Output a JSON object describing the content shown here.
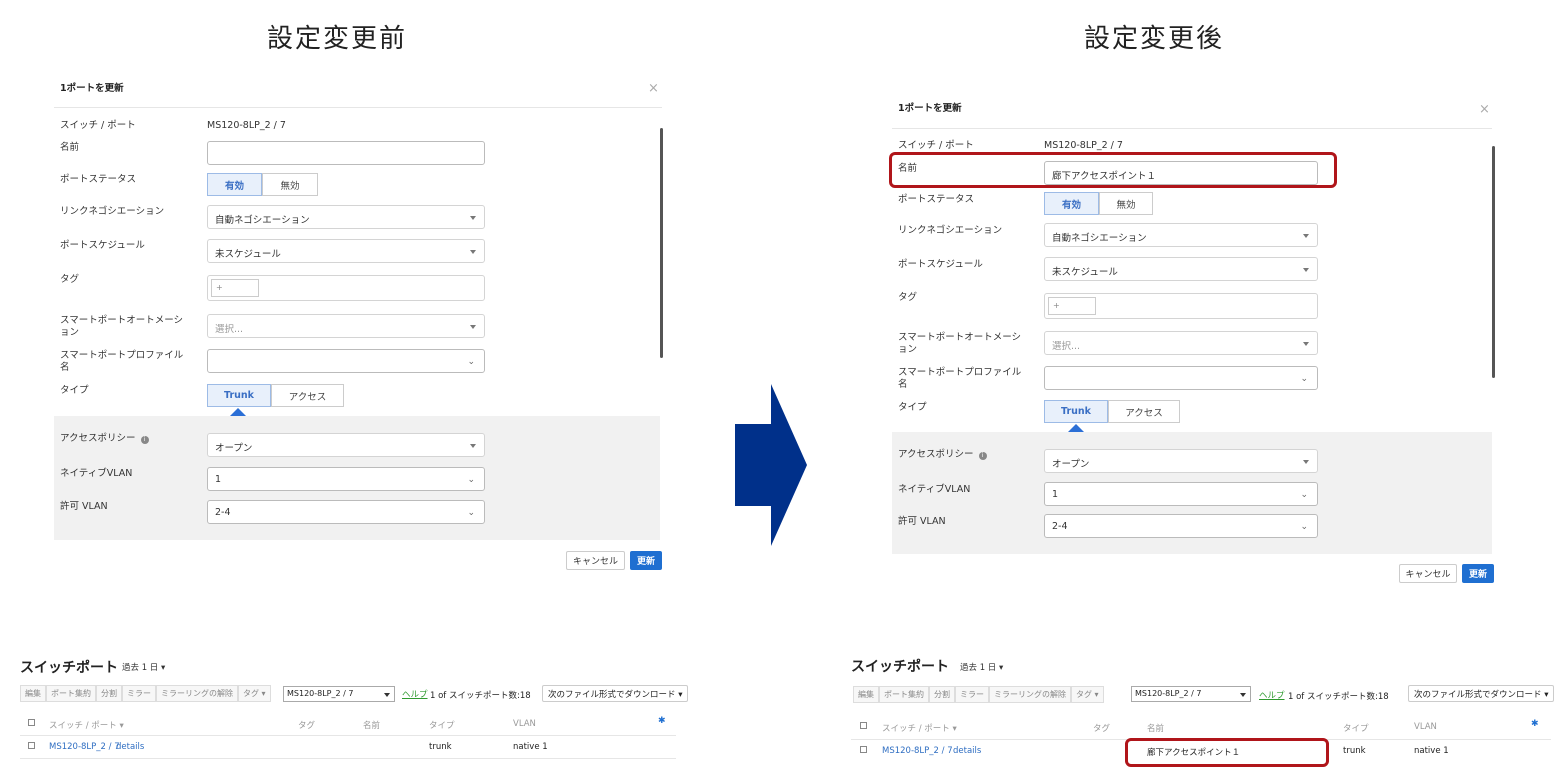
{
  "headings": {
    "before": "設定変更前",
    "after": "設定変更後"
  },
  "modal": {
    "title": "1ポートを更新",
    "close": "×",
    "labels": {
      "switch_port": "スイッチ / ポート",
      "name": "名前",
      "port_status": "ポートステータス",
      "link_negotiation": "リンクネゴシエーション",
      "port_schedule": "ポートスケジュール",
      "tag": "タグ",
      "smart_automation": "スマートポートオートメーション",
      "smart_automation_line1": "スマートポートオートメーシ",
      "smart_automation_line2": "ョン",
      "smart_profile_line1": "スマートポートプロファイル",
      "smart_profile_line2": "名",
      "type": "タイプ",
      "access_policy": "アクセスポリシー",
      "native_vlan": "ネイティブVLAN",
      "allowed_vlan": "許可 VLAN"
    },
    "switch_port_value": "MS120-8LP_2 / 7",
    "status_enabled": "有効",
    "status_disabled": "無効",
    "link_negotiation_value": "自動ネゴシエーション",
    "schedule_value": "未スケジュール",
    "tag_placeholder": "+",
    "automation_placeholder": "選択...",
    "type_trunk": "Trunk",
    "type_access": "アクセス",
    "info_icon": "i",
    "access_policy_value": "オープン",
    "native_vlan_value": "1",
    "allowed_vlan_value": "2-4",
    "cancel": "キャンセル",
    "update": "更新"
  },
  "before": {
    "name_value": ""
  },
  "after": {
    "name_value": "廊下アクセスポイント１"
  },
  "table": {
    "title": "スイッチポート",
    "period": "過去 1 日 ▾",
    "toolbar": [
      "編集",
      "ポート集約",
      "分割",
      "ミラー",
      "ミラーリングの解除",
      "タグ ▾"
    ],
    "filter_value": "MS120-8LP_2 / 7",
    "help": "ヘルプ",
    "count": "1 of スイッチポート数:18",
    "download": "次のファイル形式でダウンロード ▾",
    "headers": {
      "switch_port": "スイッチ / ポート ▾",
      "tag": "タグ",
      "name": "名前",
      "type": "タイプ",
      "vlan": "VLAN"
    },
    "gear_icon": "✱",
    "row": {
      "port": "MS120-8LP_2 / 7",
      "details": "details",
      "type": "trunk",
      "vlan": "native 1"
    }
  },
  "table_before": {
    "row_name": ""
  },
  "table_after": {
    "row_name": "廊下アクセスポイント１"
  },
  "colors": {
    "primary": "#1f6fd1",
    "highlight": "#b0151a",
    "arrow": "#00308a"
  }
}
